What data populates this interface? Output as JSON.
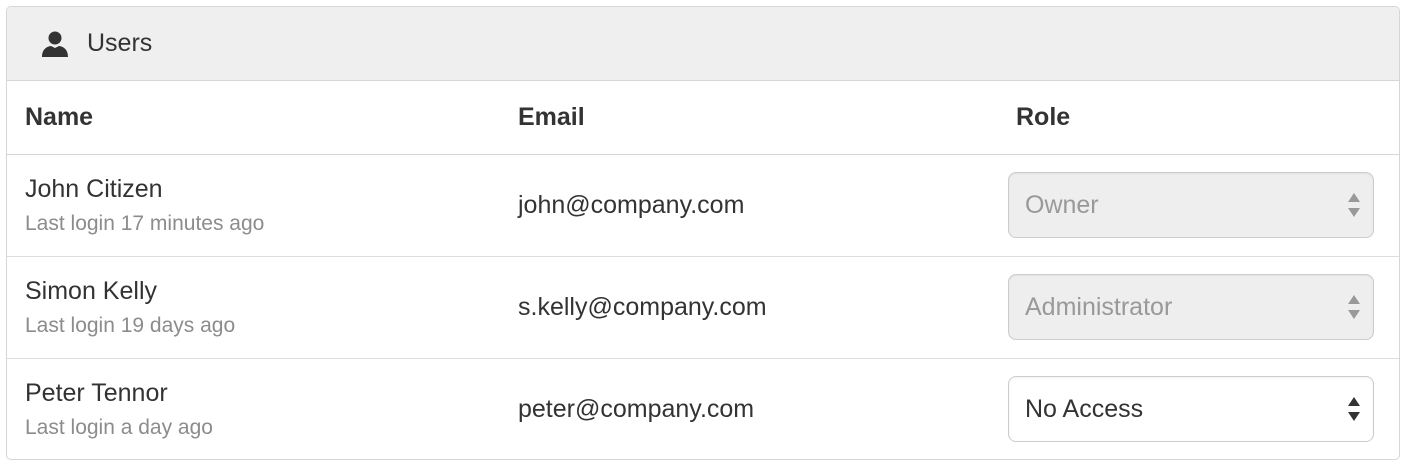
{
  "panel": {
    "title": "Users",
    "icon": "user-icon"
  },
  "table": {
    "headers": {
      "name": "Name",
      "email": "Email",
      "role": "Role"
    },
    "rows": [
      {
        "name": "John Citizen",
        "last_login": "Last login 17 minutes ago",
        "email": "john@company.com",
        "role": "Owner",
        "role_disabled": true
      },
      {
        "name": "Simon Kelly",
        "last_login": "Last login 19 days ago",
        "email": "s.kelly@company.com",
        "role": "Administrator",
        "role_disabled": true
      },
      {
        "name": "Peter Tennor",
        "last_login": "Last login a day ago",
        "email": "peter@company.com",
        "role": "No Access",
        "role_disabled": false
      }
    ]
  },
  "colors": {
    "heading_background": "#efefef",
    "border": "#d6d6d6",
    "text": "#333333",
    "muted_text": "#8c8c8c",
    "disabled_select_background": "#eeeeee",
    "disabled_select_text": "#999999"
  }
}
